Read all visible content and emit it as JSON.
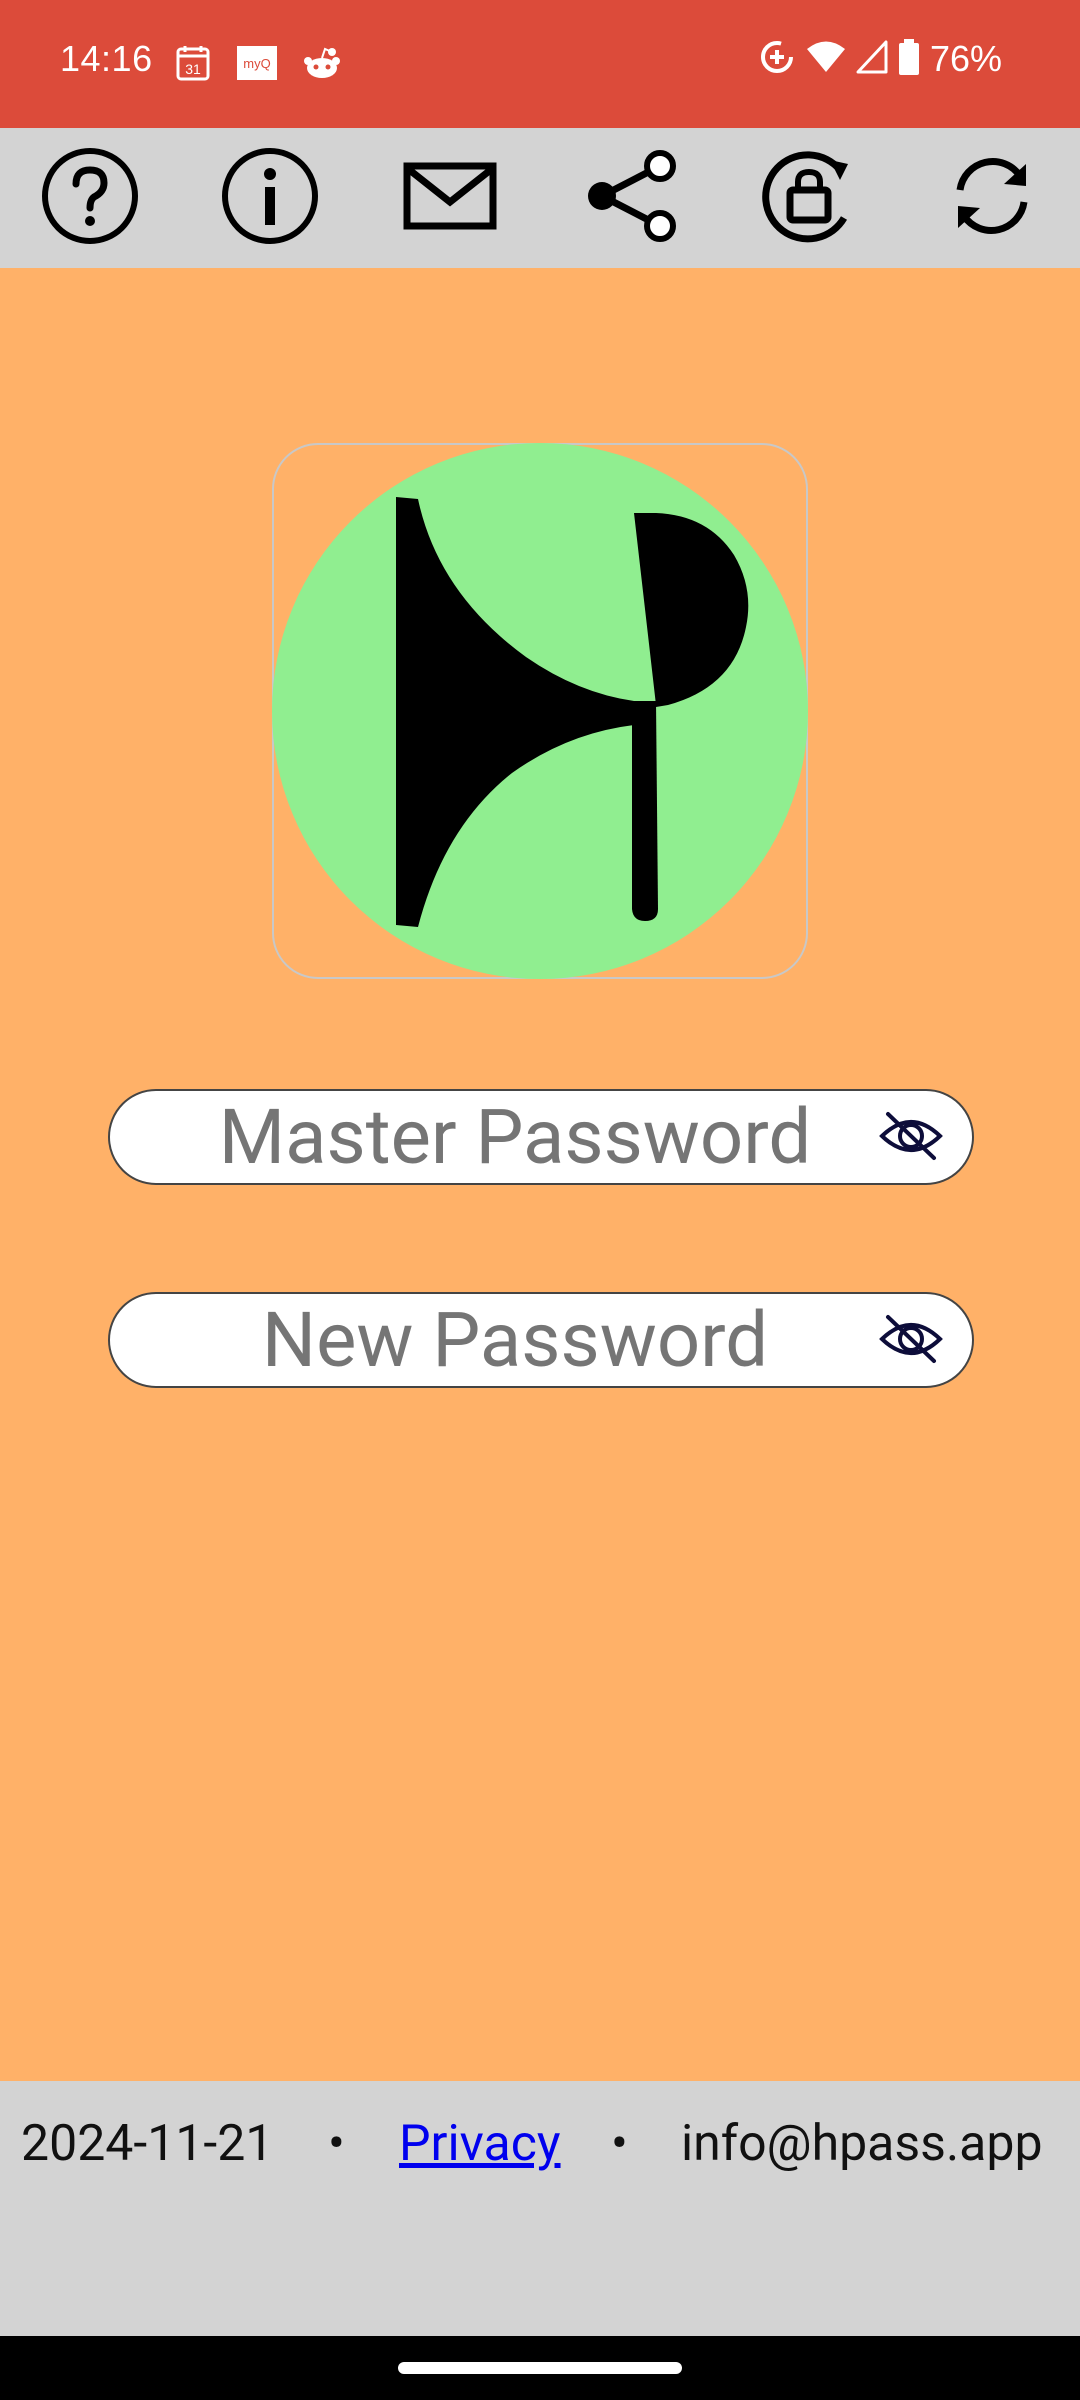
{
  "status_bar": {
    "time": "14:16",
    "battery": "76%",
    "left_icons": [
      "calendar-icon",
      "myq-icon",
      "reddit-icon"
    ],
    "right_icons": [
      "data-saver-icon",
      "wifi-icon",
      "signal-icon",
      "battery-icon"
    ],
    "calendar_day": "31",
    "myq_label": "myQ"
  },
  "toolbar": {
    "buttons": [
      {
        "name": "help",
        "icon": "question-circle-icon"
      },
      {
        "name": "info",
        "icon": "info-circle-icon"
      },
      {
        "name": "email",
        "icon": "envelope-icon"
      },
      {
        "name": "share",
        "icon": "share-icon"
      },
      {
        "name": "lock-rotate",
        "icon": "lock-rotate-icon"
      },
      {
        "name": "refresh",
        "icon": "refresh-icon"
      }
    ]
  },
  "form": {
    "master_password": {
      "placeholder": "Master Password",
      "value": ""
    },
    "new_password": {
      "placeholder": "New Password",
      "value": ""
    }
  },
  "footer": {
    "date": "2024-11-21",
    "separator": "•",
    "privacy_link": "Privacy",
    "email": "info@hpass.app"
  },
  "colors": {
    "status_bar": "#DC4B3A",
    "toolbar": "#D3D3D3",
    "background": "#FFB168",
    "logo_circle": "#90EE90",
    "link": "#0000EE"
  }
}
